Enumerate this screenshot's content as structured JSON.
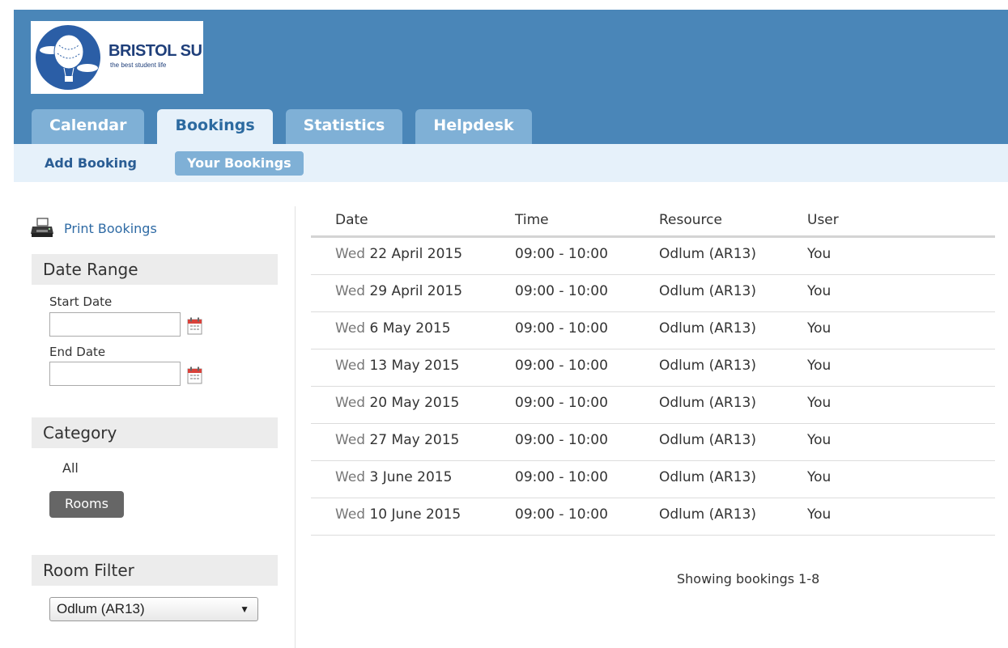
{
  "brand": {
    "name": "BRISTOL SU",
    "tagline": "the best student life"
  },
  "tabs": [
    {
      "label": "Calendar",
      "active": false
    },
    {
      "label": "Bookings",
      "active": true
    },
    {
      "label": "Statistics",
      "active": false
    },
    {
      "label": "Helpdesk",
      "active": false
    }
  ],
  "subnav": {
    "add_booking": "Add Booking",
    "your_bookings": "Your Bookings"
  },
  "sidebar": {
    "print_label": "Print Bookings",
    "date_range": {
      "heading": "Date Range",
      "start_label": "Start Date",
      "start_value": "",
      "end_label": "End Date",
      "end_value": ""
    },
    "category": {
      "heading": "Category",
      "options": [
        "All",
        "Rooms"
      ],
      "selected": "Rooms"
    },
    "room_filter": {
      "heading": "Room Filter",
      "selected": "Odlum (AR13)"
    }
  },
  "table": {
    "headers": {
      "date": "Date",
      "time": "Time",
      "resource": "Resource",
      "user": "User"
    },
    "rows": [
      {
        "dow": "Wed",
        "date": "22 April 2015",
        "time": "09:00 - 10:00",
        "resource": "Odlum (AR13)",
        "user": "You"
      },
      {
        "dow": "Wed",
        "date": "29 April 2015",
        "time": "09:00 - 10:00",
        "resource": "Odlum (AR13)",
        "user": "You"
      },
      {
        "dow": "Wed",
        "date": "6 May 2015",
        "time": "09:00 - 10:00",
        "resource": "Odlum (AR13)",
        "user": "You"
      },
      {
        "dow": "Wed",
        "date": "13 May 2015",
        "time": "09:00 - 10:00",
        "resource": "Odlum (AR13)",
        "user": "You"
      },
      {
        "dow": "Wed",
        "date": "20 May 2015",
        "time": "09:00 - 10:00",
        "resource": "Odlum (AR13)",
        "user": "You"
      },
      {
        "dow": "Wed",
        "date": "27 May 2015",
        "time": "09:00 - 10:00",
        "resource": "Odlum (AR13)",
        "user": "You"
      },
      {
        "dow": "Wed",
        "date": "3 June 2015",
        "time": "09:00 - 10:00",
        "resource": "Odlum (AR13)",
        "user": "You"
      },
      {
        "dow": "Wed",
        "date": "10 June 2015",
        "time": "09:00 - 10:00",
        "resource": "Odlum (AR13)",
        "user": "You"
      }
    ],
    "summary": "Showing bookings 1-8"
  },
  "colors": {
    "header_blue": "#4a86b8",
    "tab_inactive": "#7fb0d6",
    "subnav_bg": "#e6f1fa",
    "link_blue": "#2e6aa4",
    "logo_navy": "#1f3f7a"
  }
}
